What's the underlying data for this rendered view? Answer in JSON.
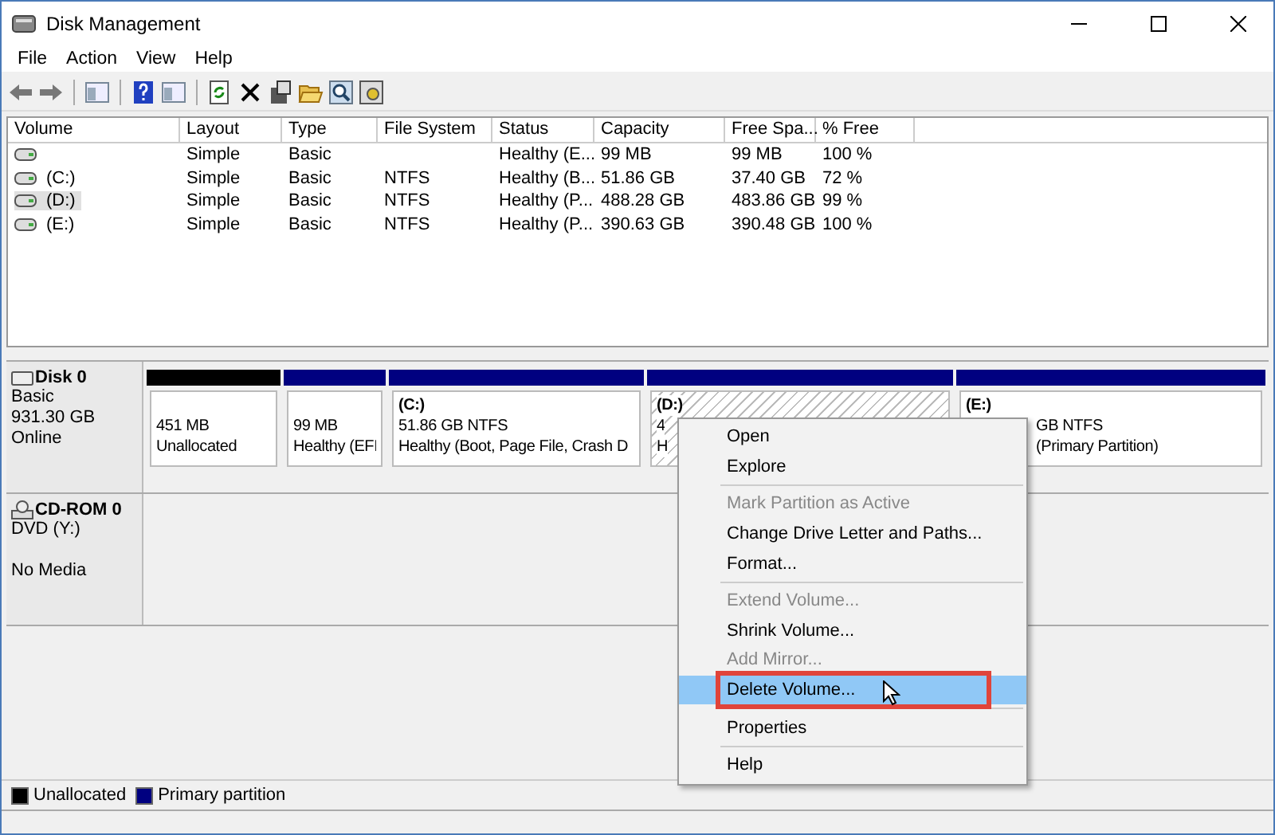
{
  "window": {
    "title": "Disk Management"
  },
  "menu": [
    "File",
    "Action",
    "View",
    "Help"
  ],
  "table": {
    "columns": [
      "Volume",
      "Layout",
      "Type",
      "File System",
      "Status",
      "Capacity",
      "Free Spa...",
      "% Free"
    ],
    "rows": [
      {
        "selected": false,
        "cells": [
          "",
          "Simple",
          "Basic",
          "",
          "Healthy (E...",
          "99 MB",
          "99 MB",
          "100 %"
        ]
      },
      {
        "selected": false,
        "cells": [
          "(C:)",
          "Simple",
          "Basic",
          "NTFS",
          "Healthy (B...",
          "51.86 GB",
          "37.40 GB",
          "72 %"
        ]
      },
      {
        "selected": true,
        "cells": [
          "(D:)",
          "Simple",
          "Basic",
          "NTFS",
          "Healthy (P...",
          "488.28 GB",
          "483.86 GB",
          "99 %"
        ]
      },
      {
        "selected": false,
        "cells": [
          "(E:)",
          "Simple",
          "Basic",
          "NTFS",
          "Healthy (P...",
          "390.63 GB",
          "390.48 GB",
          "100 %"
        ]
      }
    ]
  },
  "disks": [
    {
      "kind": "disk",
      "name": "Disk 0",
      "type": "Basic",
      "size": "931.30 GB",
      "status": "Online",
      "partitions": [
        {
          "kind": "unallocated",
          "selected": false,
          "size": "451 MB",
          "status": "Unallocated"
        },
        {
          "kind": "primary",
          "selected": false,
          "size": "99 MB",
          "status": "Healthy (EFI"
        },
        {
          "kind": "primary",
          "selected": false,
          "label": "(C:)",
          "size": "51.86 GB NTFS",
          "status": "Healthy (Boot, Page File, Crash D"
        },
        {
          "kind": "primary",
          "selected": true,
          "label": "(D:)",
          "size": "4",
          "status": "H"
        },
        {
          "kind": "primary",
          "selected": false,
          "label": "(E:)",
          "size": "GB NTFS",
          "status": "(Primary Partition)"
        }
      ]
    },
    {
      "kind": "cdrom",
      "name": "CD-ROM 0",
      "type": "DVD (Y:)",
      "status": "No Media"
    }
  ],
  "context_menu": [
    {
      "kind": "item",
      "label": "Open",
      "disabled": false,
      "selected": false
    },
    {
      "kind": "item",
      "label": "Explore",
      "disabled": false,
      "selected": false
    },
    {
      "kind": "separator"
    },
    {
      "kind": "item",
      "label": "Mark Partition as Active",
      "disabled": true,
      "selected": false
    },
    {
      "kind": "item",
      "label": "Change Drive Letter and Paths...",
      "disabled": false,
      "selected": false
    },
    {
      "kind": "item",
      "label": "Format...",
      "disabled": false,
      "selected": false
    },
    {
      "kind": "separator"
    },
    {
      "kind": "item",
      "label": "Extend Volume...",
      "disabled": true,
      "selected": false
    },
    {
      "kind": "item",
      "label": "Shrink Volume...",
      "disabled": false,
      "selected": false
    },
    {
      "kind": "item",
      "label": "Add Mirror...",
      "disabled": true,
      "selected": false
    },
    {
      "kind": "item",
      "label": "Delete Volume...",
      "disabled": false,
      "selected": true
    },
    {
      "kind": "separator"
    },
    {
      "kind": "item",
      "label": "Properties",
      "disabled": false,
      "selected": false
    },
    {
      "kind": "separator"
    },
    {
      "kind": "item",
      "label": "Help",
      "disabled": false,
      "selected": false
    }
  ],
  "legend": [
    {
      "label": "Unallocated",
      "color": "#000000"
    },
    {
      "label": "Primary partition",
      "color": "#000080"
    }
  ]
}
